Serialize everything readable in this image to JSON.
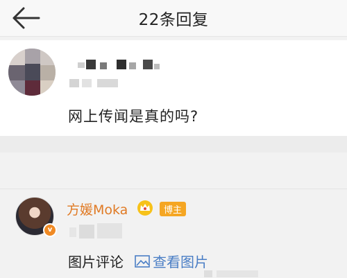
{
  "header": {
    "title": "22条回复"
  },
  "post": {
    "text": "网上传闻是真的吗?"
  },
  "reply": {
    "name": "方媛Moka",
    "badge": "博主",
    "text": "图片评论",
    "link": "查看图片"
  },
  "icons": {
    "back": "back-arrow-icon",
    "crown": "crown-icon",
    "image": "image-icon",
    "vip": "vip-badge-icon"
  },
  "colors": {
    "name": "#e07a24",
    "badge": "#f5a623",
    "link": "#4a7ec5"
  }
}
